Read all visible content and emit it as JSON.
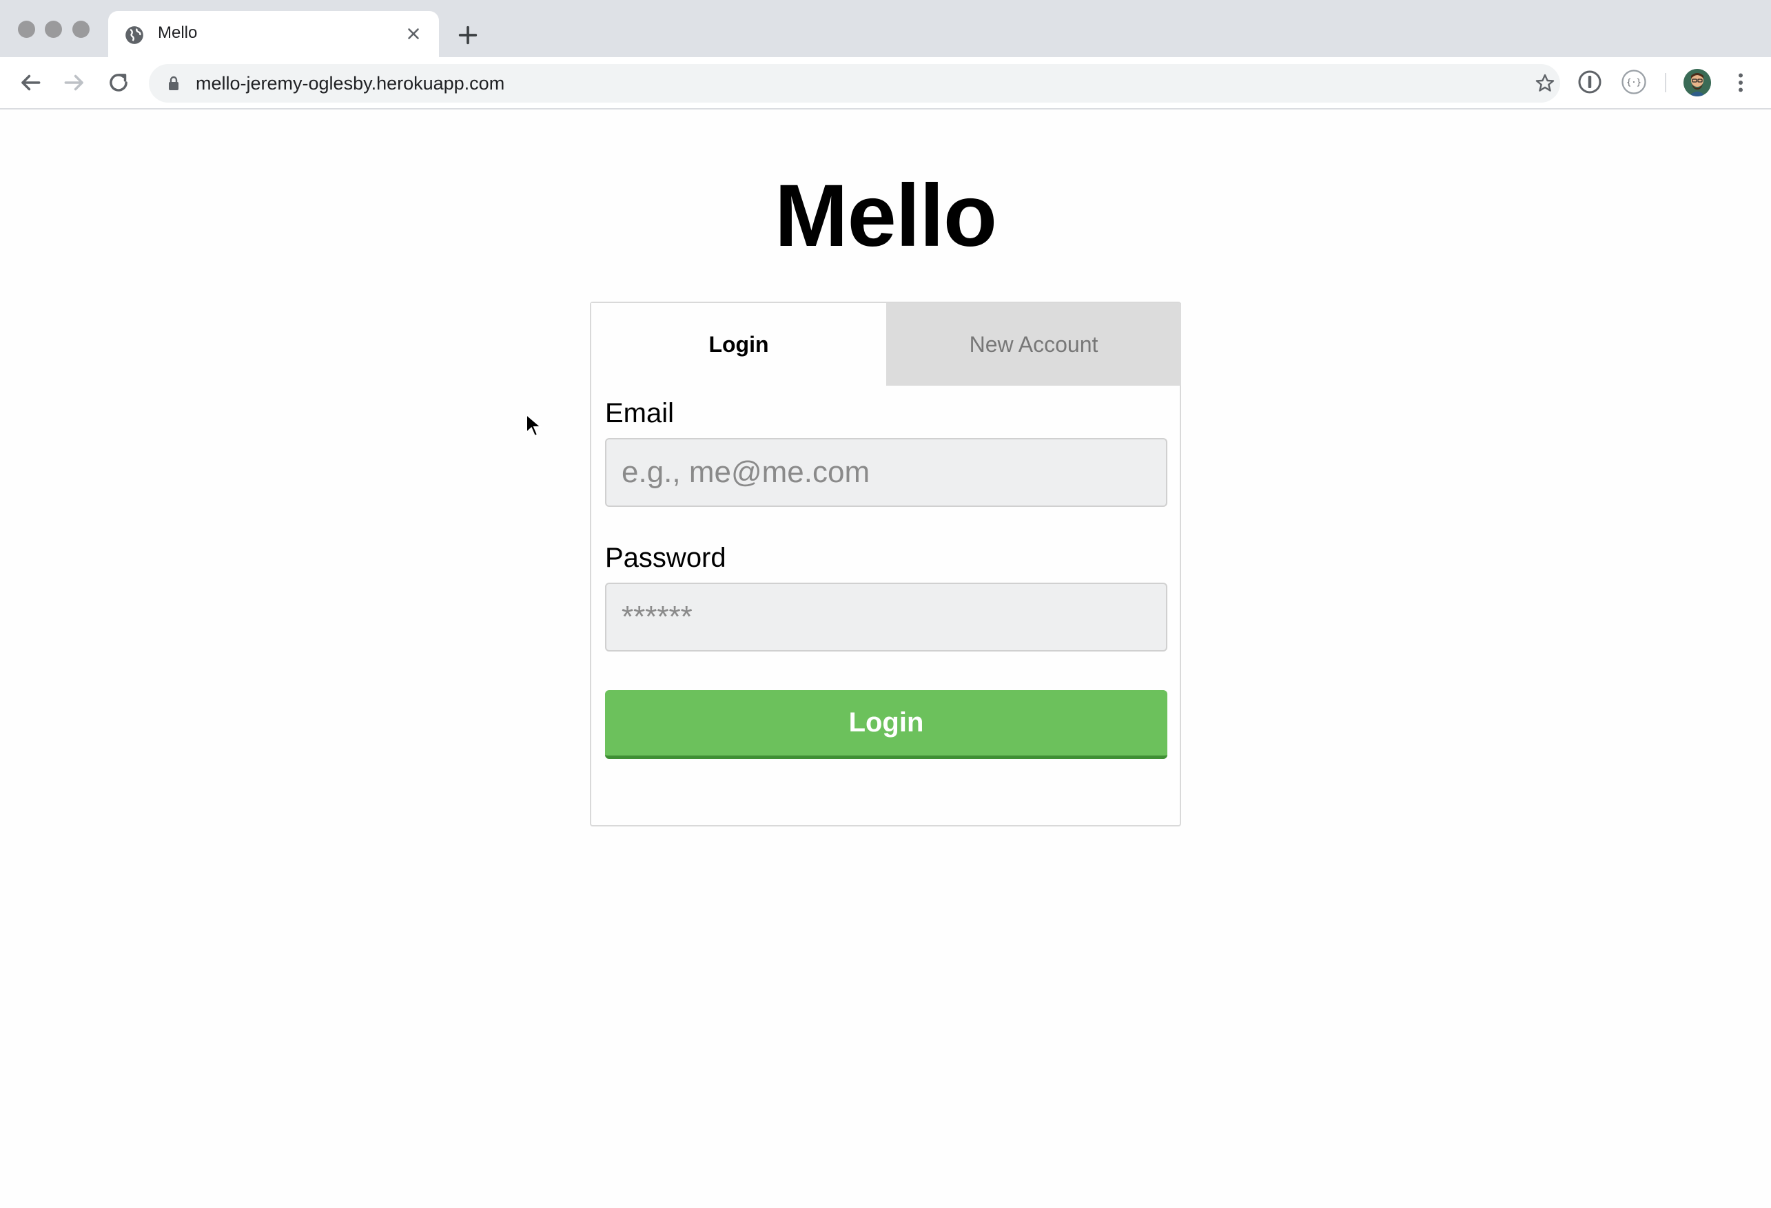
{
  "browser": {
    "tab_title": "Mello",
    "url": "mello-jeremy-oglesby.herokuapp.com"
  },
  "page": {
    "title": "Mello",
    "tabs": {
      "login": "Login",
      "new_account": "New Account"
    },
    "form": {
      "email_label": "Email",
      "email_placeholder": "e.g., me@me.com",
      "password_label": "Password",
      "password_placeholder": "******",
      "submit_label": "Login"
    }
  },
  "colors": {
    "primary_button": "#6cc15c",
    "inactive_tab": "#dcdcdc"
  }
}
